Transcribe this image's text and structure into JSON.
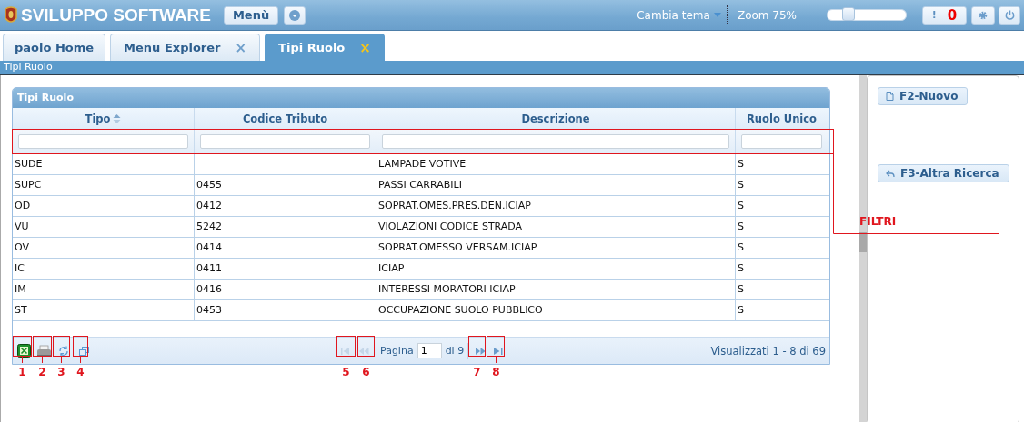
{
  "header": {
    "title": "SVILUPPO SOFTWARE",
    "menu_button": "Menù",
    "theme_menu": "Cambia tema",
    "zoom_label": "Zoom 75%",
    "zoom": {
      "level": 0.27
    },
    "alert_mark": "!",
    "alert_count": "0"
  },
  "tabs": [
    {
      "label": "paolo Home",
      "selected": false,
      "closable": false
    },
    {
      "label": "Menu Explorer",
      "selected": false,
      "closable": true,
      "close": "×"
    },
    {
      "label": "Tipi Ruolo",
      "selected": true,
      "closable": true,
      "close": "×"
    }
  ],
  "breadcrumb": "Tipi Ruolo",
  "grid": {
    "title": "Tipi Ruolo",
    "columns": [
      {
        "label": "Tipo",
        "sorted": true
      },
      {
        "label": "Codice Tributo",
        "sorted": false
      },
      {
        "label": "Descrizione",
        "sorted": false
      },
      {
        "label": "Ruolo Unico",
        "sorted": false
      }
    ],
    "rows": [
      [
        "SUDE",
        "",
        "LAMPADE VOTIVE",
        "S"
      ],
      [
        "SUPC",
        "0455",
        "PASSI CARRABILI",
        "S"
      ],
      [
        "OD",
        "0412",
        "SOPRAT.OMES.PRES.DEN.ICIAP",
        "S"
      ],
      [
        "VU",
        "5242",
        "VIOLAZIONI CODICE STRADA",
        "S"
      ],
      [
        "OV",
        "0414",
        "SOPRAT.OMESSO VERSAM.ICIAP",
        "S"
      ],
      [
        "IC",
        "0411",
        "ICIAP",
        "S"
      ],
      [
        "IM",
        "0416",
        "INTERESSI MORATORI ICIAP",
        "S"
      ],
      [
        "ST",
        "0453",
        "OCCUPAZIONE SUOLO PUBBLICO",
        "S"
      ]
    ],
    "tools": [
      {
        "kind": "excel"
      },
      {
        "kind": "print"
      },
      {
        "kind": "refresh"
      },
      {
        "kind": "window"
      }
    ],
    "pager": {
      "nav_before": [
        {
          "kind": "first",
          "disabled": true
        },
        {
          "kind": "prev",
          "disabled": true
        }
      ],
      "page_label": "Pagina",
      "page": "1",
      "of": "di 9",
      "nav_after": [
        {
          "kind": "next",
          "disabled": false
        },
        {
          "kind": "last",
          "disabled": false
        }
      ],
      "summary": "Visualizzati 1 - 8 di 69"
    }
  },
  "side_buttons": [
    {
      "kind": "new",
      "label": "F2-Nuovo"
    },
    {
      "kind": "back",
      "label": "F3-Altra Ricerca"
    }
  ],
  "annotations": {
    "numbers": [
      "1",
      "2",
      "3",
      "4",
      "5",
      "6",
      "7",
      "8"
    ],
    "filter_label": "FILTRI"
  }
}
